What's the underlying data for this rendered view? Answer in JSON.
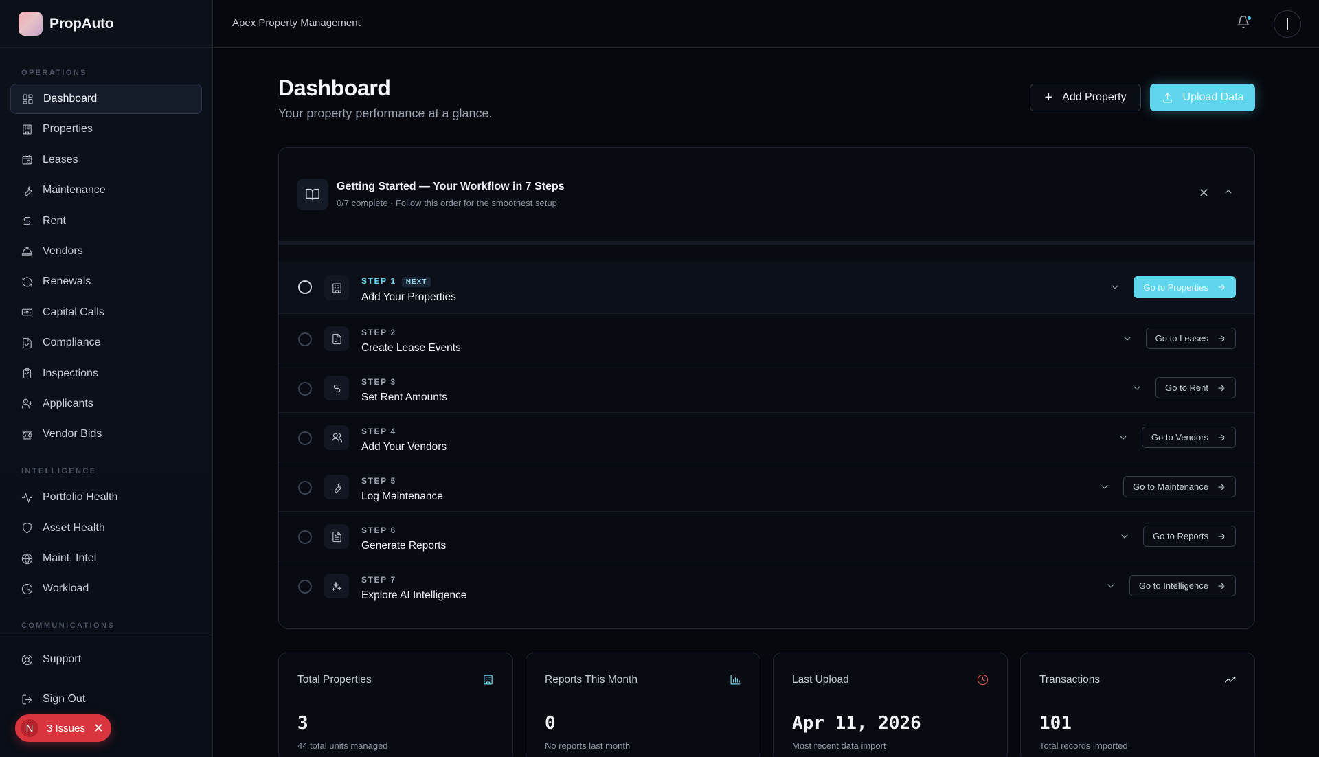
{
  "brand": {
    "name": "PropAuto"
  },
  "topbar": {
    "org": "Apex Property Management"
  },
  "sidebar": {
    "operations_title": "OPERATIONS",
    "operations": [
      {
        "label": "Dashboard",
        "icon": "grid-icon",
        "active": true
      },
      {
        "label": "Properties",
        "icon": "building-icon"
      },
      {
        "label": "Leases",
        "icon": "calendar-icon"
      },
      {
        "label": "Maintenance",
        "icon": "wrench-icon"
      },
      {
        "label": "Rent",
        "icon": "dollar-icon"
      },
      {
        "label": "Vendors",
        "icon": "hardhat-icon"
      },
      {
        "label": "Renewals",
        "icon": "refresh-icon"
      },
      {
        "label": "Capital Calls",
        "icon": "banknote-icon"
      },
      {
        "label": "Compliance",
        "icon": "file-check-icon"
      },
      {
        "label": "Inspections",
        "icon": "clipboard-icon"
      },
      {
        "label": "Applicants",
        "icon": "user-plus-icon"
      },
      {
        "label": "Vendor Bids",
        "icon": "scale-icon"
      }
    ],
    "intelligence_title": "INTELLIGENCE",
    "intelligence": [
      {
        "label": "Portfolio Health",
        "icon": "activity-icon"
      },
      {
        "label": "Asset Health",
        "icon": "shield-icon"
      },
      {
        "label": "Maint. Intel",
        "icon": "globe-icon"
      },
      {
        "label": "Workload",
        "icon": "clock-icon"
      }
    ],
    "communications_title": "COMMUNICATIONS",
    "bottom": [
      {
        "label": "Support",
        "icon": "lifebuoy-icon"
      },
      {
        "label": "Sign Out",
        "icon": "logout-icon"
      }
    ],
    "issues": {
      "avatar": "N",
      "label": "3 Issues"
    }
  },
  "header": {
    "title": "Dashboard",
    "subtitle": "Your property performance at a glance.",
    "add_property": "Add Property",
    "upload_data": "Upload Data"
  },
  "getting_started": {
    "title": "Getting Started — Your Workflow in 7 Steps",
    "subtitle": "0/7 complete · Follow this order for the smoothest setup",
    "progress_fraction": 0,
    "next_badge": "NEXT",
    "steps": [
      {
        "label": "STEP 1",
        "title": "Add Your Properties",
        "action": "Go to Properties",
        "icon": "building-icon"
      },
      {
        "label": "STEP 2",
        "title": "Create Lease Events",
        "action": "Go to Leases",
        "icon": "file-signature-icon"
      },
      {
        "label": "STEP 3",
        "title": "Set Rent Amounts",
        "action": "Go to Rent",
        "icon": "dollar-icon"
      },
      {
        "label": "STEP 4",
        "title": "Add Your Vendors",
        "action": "Go to Vendors",
        "icon": "users-icon"
      },
      {
        "label": "STEP 5",
        "title": "Log Maintenance",
        "action": "Go to Maintenance",
        "icon": "wrench-icon"
      },
      {
        "label": "STEP 6",
        "title": "Generate Reports",
        "action": "Go to Reports",
        "icon": "file-text-icon"
      },
      {
        "label": "STEP 7",
        "title": "Explore AI Intelligence",
        "action": "Go to Intelligence",
        "icon": "sparkles-icon"
      }
    ]
  },
  "stats": [
    {
      "label": "Total Properties",
      "value": "3",
      "desc": "44 total units managed",
      "icon": "building-icon"
    },
    {
      "label": "Reports This Month",
      "value": "0",
      "desc": "No reports last month",
      "icon": "bar-chart-icon"
    },
    {
      "label": "Last Upload",
      "value": "Apr 11, 2026",
      "desc": "Most recent data import",
      "icon": "clock-icon",
      "icon_color": "#e0524f"
    },
    {
      "label": "Transactions",
      "value": "101",
      "desc": "Total records imported",
      "icon": "trending-up-icon"
    }
  ],
  "colors": {
    "accent": "#5fd6ee",
    "danger": "#d9353e"
  }
}
